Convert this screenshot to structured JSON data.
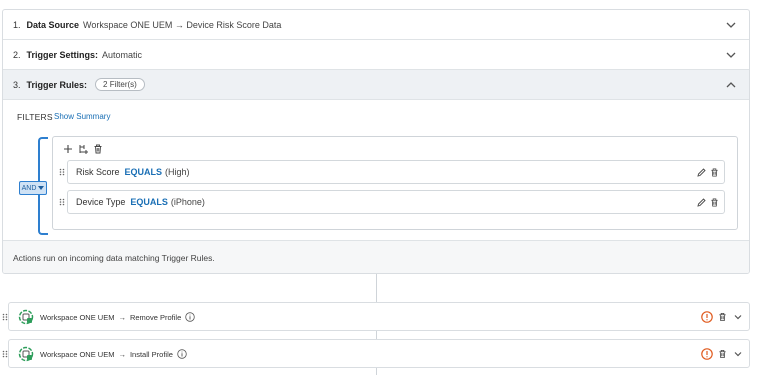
{
  "accordion": {
    "step1": {
      "number": "1.",
      "title": "Data Source",
      "value": "Workspace ONE UEM → Device Risk Score Data"
    },
    "step2": {
      "number": "2.",
      "title": "Trigger Settings:",
      "value": "Automatic"
    },
    "step3": {
      "number": "3.",
      "title": "Trigger Rules:",
      "filter_count": "2 Filter(s)"
    }
  },
  "filters": {
    "label": "FILTERS",
    "show_summary": "Show Summary",
    "operator": "AND",
    "rules": [
      {
        "field": "Risk Score",
        "op": "EQUALS",
        "value": "(High)"
      },
      {
        "field": "Device Type",
        "op": "EQUALS",
        "value": "(iPhone)"
      }
    ]
  },
  "actions_note": "Actions run on incoming data matching Trigger Rules.",
  "action_cards": [
    {
      "source": "Workspace ONE UEM",
      "arrow": "→",
      "action": "Remove Profile"
    },
    {
      "source": "Workspace ONE UEM",
      "arrow": "→",
      "action": "Install Profile"
    }
  ],
  "icons": {
    "chevron": "chevron-down-icon",
    "chevron_up": "chevron-up-icon",
    "add": "plus-icon",
    "subgroup": "add-subgroup-icon",
    "delete": "trash-icon",
    "edit": "pencil-icon",
    "drag": "drag-handle-icon",
    "warning": "warning-icon",
    "info": "info-icon",
    "connector": "workspace-one-uem-icon"
  },
  "colors": {
    "accent": "#1a6fb5",
    "bracket": "#2e7fcf",
    "warning": "#e05b1f",
    "connector_green": "#2e9e5b"
  }
}
